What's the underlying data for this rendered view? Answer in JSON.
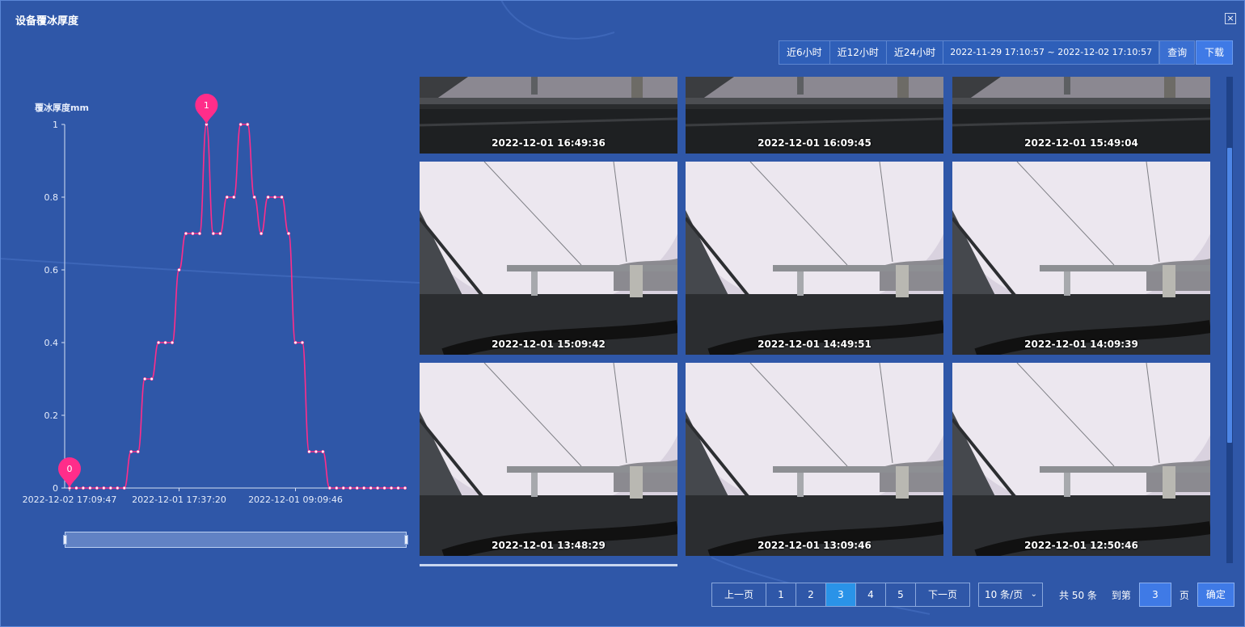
{
  "window": {
    "title": "设备覆冰厚度",
    "close_icon": "close-icon"
  },
  "toolbar": {
    "range_buttons": [
      "近6小时",
      "近12小时",
      "近24小时"
    ],
    "date_range": "2022-11-29 17:10:57 ~ 2022-12-02 17:10:57",
    "query_label": "查询",
    "download_label": "下载"
  },
  "chart_data": {
    "type": "line",
    "ylabel": "覆冰厚度mm",
    "ylim": [
      0,
      1
    ],
    "yticks": [
      "0",
      "0.2",
      "0.4",
      "0.6",
      "0.8",
      "1"
    ],
    "xtick_labels": [
      "2022-12-02 17:09:47",
      "2022-12-01 17:37:20",
      "2022-12-01 09:09:46"
    ],
    "series": [
      {
        "color": "#ff2d8a",
        "values": [
          0,
          0,
          0,
          0,
          0,
          0,
          0,
          0,
          0,
          0.1,
          0.1,
          0.3,
          0.3,
          0.4,
          0.4,
          0.4,
          0.6,
          0.7,
          0.7,
          0.7,
          1,
          0.7,
          0.7,
          0.8,
          0.8,
          1,
          1,
          0.8,
          0.7,
          0.8,
          0.8,
          0.8,
          0.7,
          0.4,
          0.4,
          0.1,
          0.1,
          0.1,
          0,
          0,
          0,
          0,
          0,
          0,
          0,
          0,
          0,
          0,
          0,
          0
        ]
      }
    ],
    "markers": [
      {
        "label": "0",
        "index": 0,
        "value": 0
      },
      {
        "label": "1",
        "index": 20,
        "value": 1
      }
    ]
  },
  "gallery": {
    "images": [
      {
        "timestamp": "2022-12-01 16:49:36",
        "variant": "dark"
      },
      {
        "timestamp": "2022-12-01 16:09:45",
        "variant": "dark"
      },
      {
        "timestamp": "2022-12-01 15:49:04",
        "variant": "dark"
      },
      {
        "timestamp": "2022-12-01 15:09:42",
        "variant": "light"
      },
      {
        "timestamp": "2022-12-01 14:49:51",
        "variant": "light"
      },
      {
        "timestamp": "2022-12-01 14:09:39",
        "variant": "light"
      },
      {
        "timestamp": "2022-12-01 13:48:29",
        "variant": "light"
      },
      {
        "timestamp": "2022-12-01 13:09:46",
        "variant": "light"
      },
      {
        "timestamp": "2022-12-01 12:50:46",
        "variant": "light"
      }
    ]
  },
  "pagination": {
    "prev_label": "上一页",
    "pages": [
      "1",
      "2",
      "3",
      "4",
      "5"
    ],
    "current": "3",
    "next_label": "下一页",
    "page_size": "10 条/页",
    "total_text": "共 50 条",
    "goto_label": "到第",
    "goto_value": "3",
    "page_unit": "页",
    "confirm_label": "确定"
  },
  "colors": {
    "background": "#2f57a8",
    "accent": "#3f7ae6",
    "line": "#ff2d8a",
    "active_page": "#2a93e8"
  }
}
